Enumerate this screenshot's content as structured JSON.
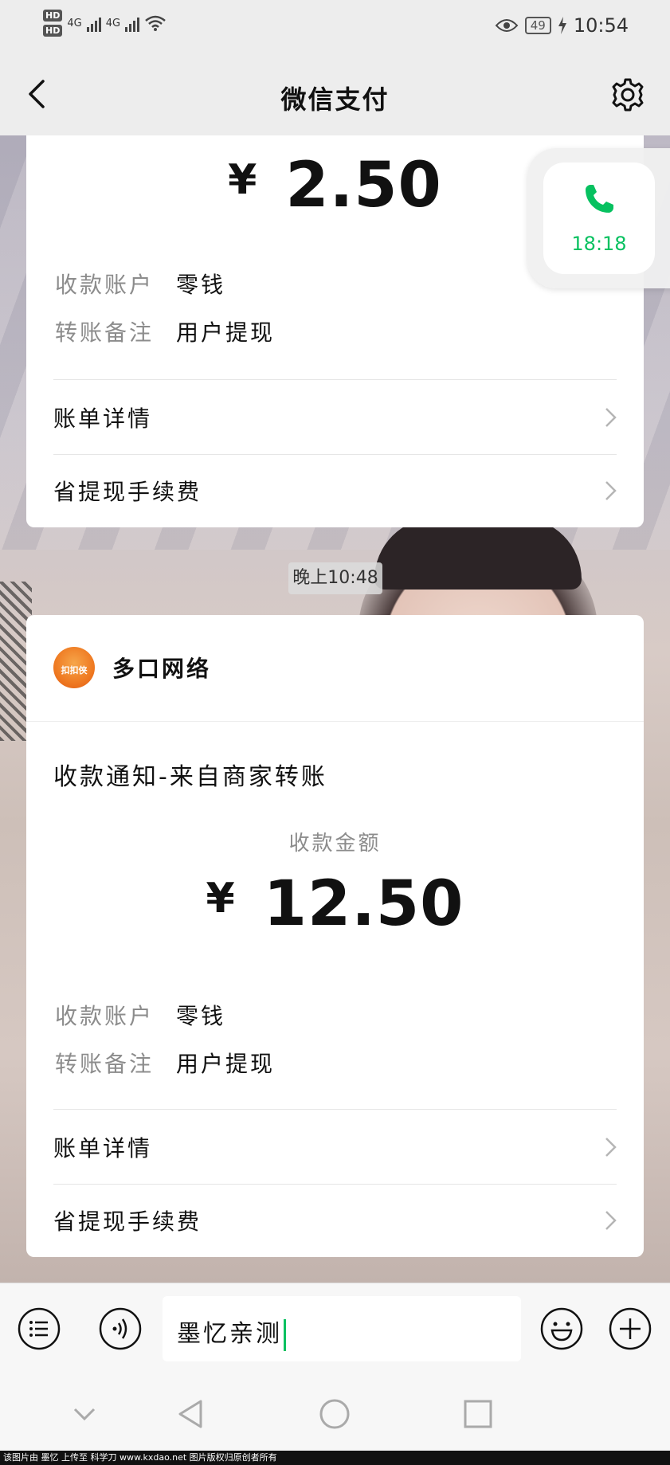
{
  "status_bar": {
    "hd1": "HD",
    "hd2": "HD",
    "net1": "4G",
    "net2": "4G",
    "battery": "49",
    "time": "10:54"
  },
  "nav": {
    "title": "微信支付"
  },
  "transfer_1": {
    "currency": "¥",
    "amount": "2.50",
    "account_label": "收款账户",
    "account_value": "零钱",
    "remark_label": "转账备注",
    "remark_value": "用户提现",
    "rows": [
      "账单详情",
      "省提现手续费"
    ]
  },
  "time_divider": "晚上10:48",
  "call_float": {
    "duration": "18:18"
  },
  "transfer_2": {
    "merchant_logo_text": "扣扣侠",
    "merchant_name": "多口网络",
    "notice_title": "收款通知-来自商家转账",
    "amount_label": "收款金额",
    "currency": "¥",
    "amount": "12.50",
    "account_label": "收款账户",
    "account_value": "零钱",
    "remark_label": "转账备注",
    "remark_value": "用户提现",
    "rows": [
      "账单详情",
      "省提现手续费"
    ]
  },
  "input_bar": {
    "text": "墨忆亲测"
  },
  "watermark": "该图片由 墨忆 上传至 科学刀 www.kxdao.net 图片版权归原创者所有",
  "colors": {
    "accent": "#07c160",
    "background": "#ededed"
  }
}
